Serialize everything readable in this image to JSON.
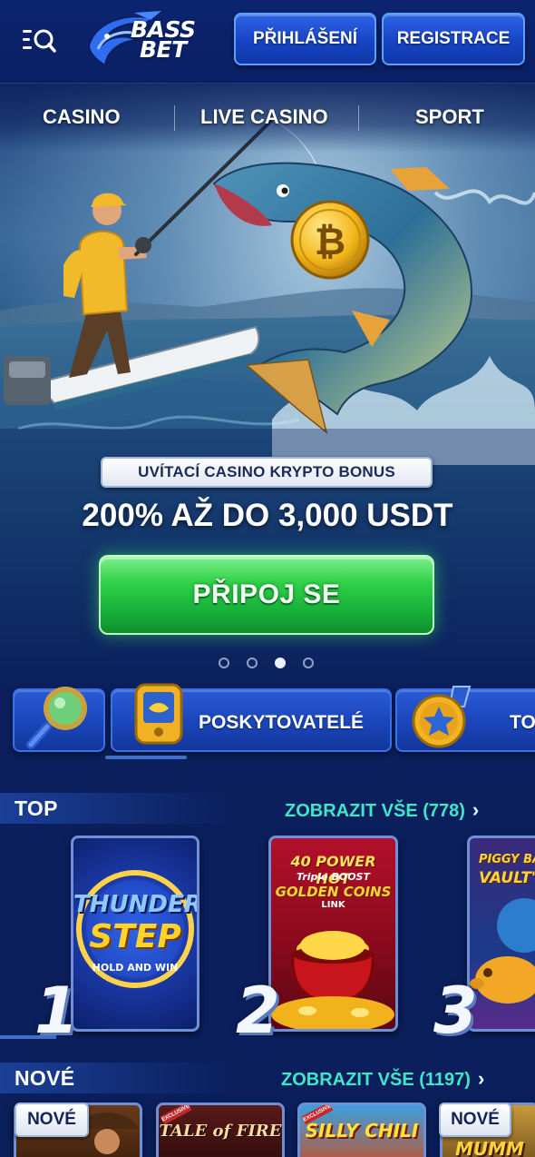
{
  "header": {
    "logo_line1": "BASS",
    "logo_line2": "BET",
    "login_label": "PŘIHLÁŠENÍ",
    "register_label": "REGISTRACE"
  },
  "nav": {
    "items": [
      "CASINO",
      "LIVE CASINO",
      "SPORT"
    ]
  },
  "hero": {
    "badge": "UVÍTACÍ CASINO KRYPTO BONUS",
    "headline": "200% AŽ DO 3,000 USDT",
    "cta_label": "PŘIPOJ SE",
    "slides_total": 4,
    "active_slide": 3
  },
  "quickbar": {
    "providers_label": "POSKYTOVATELÉ",
    "top_label": "TOP"
  },
  "top_section": {
    "title": "TOP",
    "see_all": "ZOBRAZIT VŠE (778)",
    "games": [
      {
        "rank": "1",
        "title_line1": "THUNDER",
        "title_line2": "STEP",
        "subtitle": "HOLD AND WIN"
      },
      {
        "rank": "2",
        "title_line1": "40 POWER HOT",
        "title_line2": "GOLDEN COINS",
        "subtitle": "LINK",
        "tag": "Triple BOOST"
      },
      {
        "rank": "3",
        "title_line1": "PIGGY BA",
        "title_line2": "VAULT'S"
      }
    ]
  },
  "new_section": {
    "title": "NOVÉ",
    "see_all": "ZOBRAZIT VŠE (1197)",
    "badge": "NOVÉ",
    "games": [
      {
        "title": ""
      },
      {
        "title": "TALE of FIRE",
        "tag": "EXCLUSIVE"
      },
      {
        "title": "SILLY CHILI",
        "tag": "EXCLUSIVE"
      },
      {
        "title": "MUMM"
      }
    ]
  },
  "colors": {
    "background": "#0b1f5c",
    "header_button": "#1a4ccf",
    "cta_green": "#22c840",
    "accent_teal": "#3fe6c8"
  }
}
